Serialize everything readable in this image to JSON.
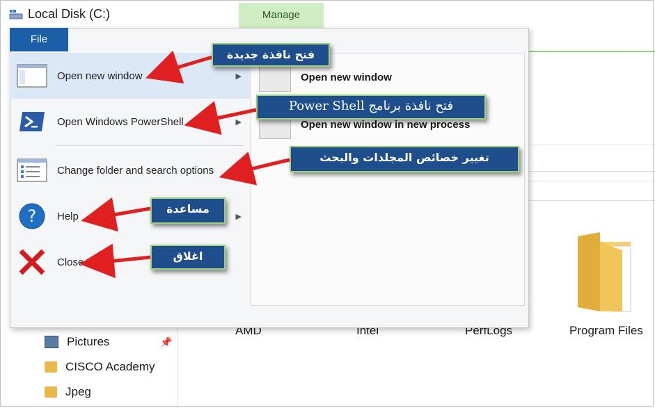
{
  "window": {
    "title": "Local Disk (C:)",
    "manage_tab": "Manage"
  },
  "ribbon": {
    "file_tab": "File"
  },
  "file_menu": {
    "items": [
      {
        "label": "Open new window",
        "icon": "new-window-icon",
        "has_submenu": true
      },
      {
        "label": "Open Windows PowerShell",
        "icon": "powershell-icon",
        "has_submenu": true
      },
      {
        "label": "Change folder and search options",
        "icon": "folder-options-icon",
        "has_submenu": false
      },
      {
        "label": "Help",
        "icon": "help-icon",
        "has_submenu": true
      },
      {
        "label": "Close",
        "icon": "close-icon",
        "has_submenu": false
      }
    ],
    "submenu": [
      {
        "label": "Open new window",
        "icon": "window-icon"
      },
      {
        "label": "Open new window in new process",
        "icon": "window-icon"
      }
    ]
  },
  "annotations": {
    "open_new_window": "فتح نافذة جديدة",
    "powershell": "فتح نافذة برنامج Power Shell",
    "folder_options": "تغيير خصائص المجلدات والبحث",
    "help": "مساعدة",
    "close": "اغلاق",
    "accent_color": "#1f4e8c",
    "border_color": "#9fd07d",
    "arrow_color": "#e02020"
  },
  "nav_pane": {
    "items": [
      {
        "label": "Pictures",
        "icon": "pictures-icon",
        "pinned": true
      },
      {
        "label": "CISCO Academy",
        "icon": "folder-icon"
      },
      {
        "label": "Jpeg",
        "icon": "folder-icon"
      }
    ]
  },
  "content": {
    "folders": [
      "AMD",
      "Intel",
      "PerfLogs",
      "Program Files"
    ]
  }
}
